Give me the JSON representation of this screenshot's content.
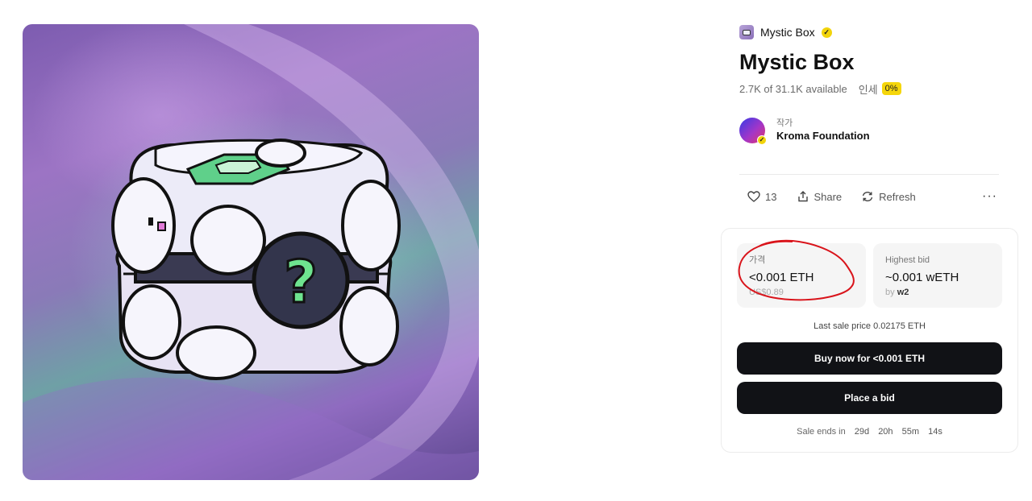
{
  "collection": {
    "name": "Mystic Box",
    "icon": "collection-thumb-icon",
    "verified": true,
    "badge_color": "#f2d40b"
  },
  "item": {
    "title": "Mystic Box",
    "availability": "2.7K of 31.1K available",
    "royalty_label": "인세",
    "royalty_value": "0%"
  },
  "creator": {
    "label": "작가",
    "name": "Kroma Foundation",
    "verified": true
  },
  "actions": {
    "likes": "13",
    "share_label": "Share",
    "refresh_label": "Refresh",
    "more_label": "···"
  },
  "price": {
    "label": "가격",
    "value": "<0.001 ETH",
    "usd": "US$0.89"
  },
  "highest_bid": {
    "label": "Highest bid",
    "value": "~0.001 wETH",
    "by_prefix": "by",
    "bidder": "w2"
  },
  "last_sale": "Last sale price 0.02175 ETH",
  "buttons": {
    "buy": "Buy now for <0.001 ETH",
    "bid": "Place a bid"
  },
  "sale_ends": {
    "label": "Sale ends in",
    "days": "29d",
    "hours": "20h",
    "minutes": "55m",
    "seconds": "14s"
  },
  "colors": {
    "button_bg": "#111216",
    "accent_yellow": "#f5d60b",
    "annotation_red": "#d9141b"
  }
}
